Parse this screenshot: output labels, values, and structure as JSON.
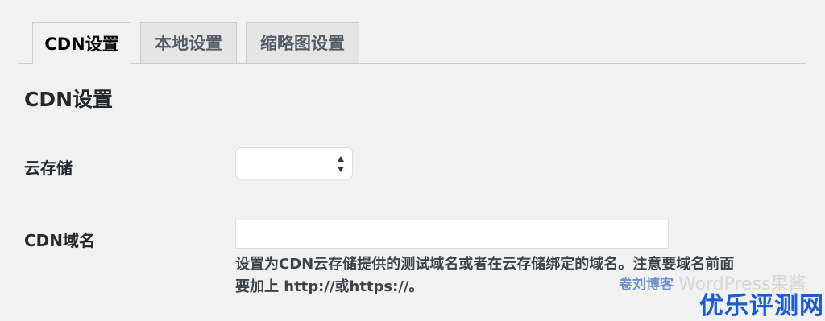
{
  "tabs": [
    {
      "label": "CDN设置",
      "active": true
    },
    {
      "label": "本地设置",
      "active": false
    },
    {
      "label": "缩略图设置",
      "active": false
    }
  ],
  "section_title": "CDN设置",
  "fields": {
    "cloud_storage": {
      "label": "云存储",
      "selected_value": ""
    },
    "cdn_domain": {
      "label": "CDN域名",
      "value": "",
      "description_line1": "设置为CDN云存储提供的测试域名或者在云存储绑定的域名。注意要域名前面",
      "description_line2": "要加上 http://或https://。"
    }
  },
  "watermark": {
    "blog_prefix": "卷刘博客",
    "blog_name": "WordPress果酱",
    "site_name": "优乐评测网"
  },
  "colors": {
    "background": "#f1f1f1",
    "tab_inactive": "#e5e5e5",
    "watermark_blue": "#1a5bd6"
  }
}
